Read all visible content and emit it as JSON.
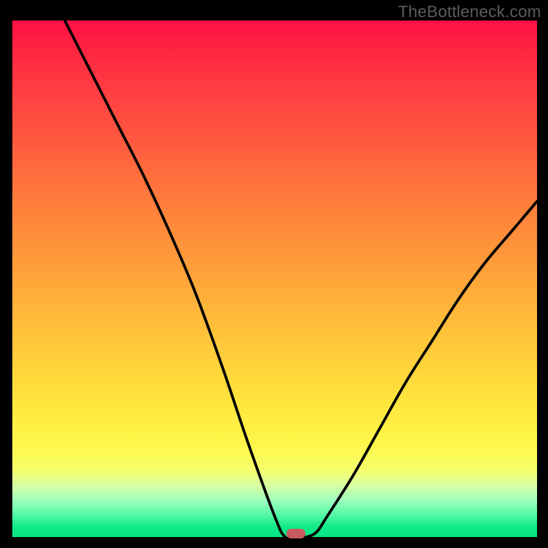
{
  "watermark": "TheBottleneck.com",
  "colors": {
    "frame": "#000000",
    "watermark_text": "#5c5c5c",
    "curve": "#000000",
    "marker": "#c75a5f",
    "gradient_stops": [
      "#ff1044",
      "#ff2d42",
      "#ff5640",
      "#ff7f3b",
      "#ffa53a",
      "#ffc93a",
      "#ffe63d",
      "#fff64a",
      "#f6ff6c",
      "#d8ffa2",
      "#9cffbe",
      "#4cf7a2",
      "#12e989",
      "#09e583"
    ]
  },
  "chart_data": {
    "type": "line",
    "title": "",
    "xlabel": "",
    "ylabel": "",
    "xlim": [
      0,
      100
    ],
    "ylim": [
      0,
      100
    ],
    "series": [
      {
        "name": "bottleneck-curve",
        "x": [
          10,
          15,
          20,
          25,
          30,
          35,
          40,
          45,
          50,
          52,
          54,
          56,
          58,
          60,
          65,
          70,
          75,
          80,
          85,
          90,
          95,
          100
        ],
        "y": [
          100,
          90,
          80,
          70,
          59,
          47,
          33,
          18,
          4,
          0,
          0,
          0,
          1,
          4,
          12,
          21,
          30,
          38,
          46,
          53,
          59,
          65
        ]
      }
    ],
    "marker": {
      "x": 54,
      "y": 0
    },
    "background_gradient": {
      "axis": "y",
      "stops": [
        {
          "y": 0,
          "color": "#09e583"
        },
        {
          "y": 5,
          "color": "#4cf7a2"
        },
        {
          "y": 10,
          "color": "#d8ffa2"
        },
        {
          "y": 18,
          "color": "#fff64a"
        },
        {
          "y": 30,
          "color": "#ffe63d"
        },
        {
          "y": 45,
          "color": "#ffc93a"
        },
        {
          "y": 60,
          "color": "#ffa53a"
        },
        {
          "y": 75,
          "color": "#ff7f3b"
        },
        {
          "y": 88,
          "color": "#ff5640"
        },
        {
          "y": 100,
          "color": "#ff1044"
        }
      ]
    }
  }
}
